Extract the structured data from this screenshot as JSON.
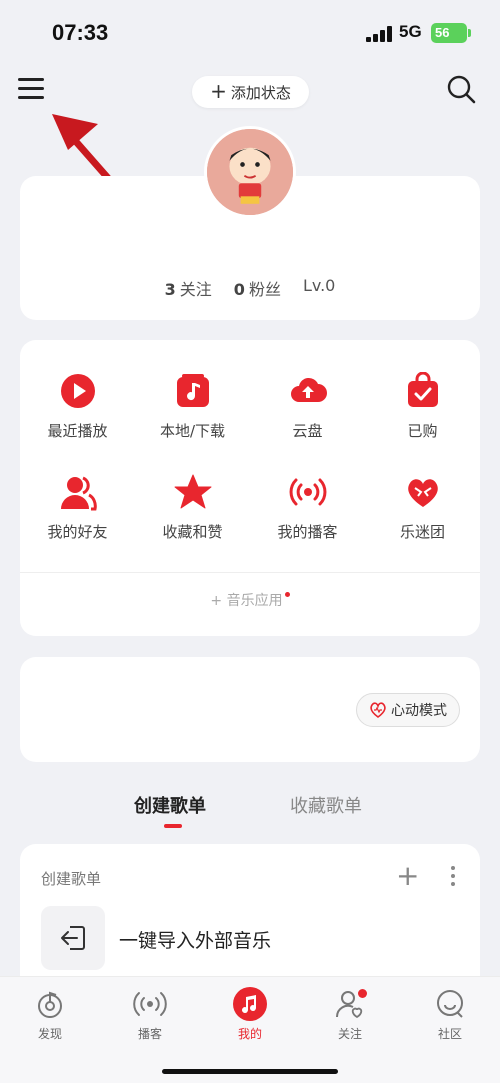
{
  "status_bar": {
    "time": "07:33",
    "network": "5G",
    "battery": "56"
  },
  "header": {
    "add_status_label": "添加状态",
    "menu_icon": "hamburger-menu-icon",
    "search_icon": "search-icon"
  },
  "profile": {
    "follows_count": "3",
    "follows_label": "关注",
    "fans_count": "0",
    "fans_label": "粉丝",
    "level": "Lv.0"
  },
  "apps": {
    "items": [
      {
        "label": "最近播放",
        "icon": "play-circle-icon"
      },
      {
        "label": "本地/下载",
        "icon": "music-note-icon"
      },
      {
        "label": "云盘",
        "icon": "cloud-upload-icon"
      },
      {
        "label": "已购",
        "icon": "shopping-bag-icon"
      },
      {
        "label": "我的好友",
        "icon": "friends-icon"
      },
      {
        "label": "收藏和赞",
        "icon": "star-icon"
      },
      {
        "label": "我的播客",
        "icon": "broadcast-icon"
      },
      {
        "label": "乐迷团",
        "icon": "heart-badge-icon"
      }
    ],
    "music_apps_label": "音乐应用"
  },
  "heart_mode": {
    "label": "心动模式"
  },
  "playlist_tabs": {
    "created": "创建歌单",
    "collected": "收藏歌单"
  },
  "playlists": {
    "header": "创建歌单",
    "import_label": "一键导入外部音乐"
  },
  "bottom_nav": [
    {
      "label": "发现",
      "icon": "discover-icon"
    },
    {
      "label": "播客",
      "icon": "podcast-icon"
    },
    {
      "label": "我的",
      "icon": "music-note-icon"
    },
    {
      "label": "关注",
      "icon": "follow-icon"
    },
    {
      "label": "社区",
      "icon": "community-icon"
    }
  ],
  "colors": {
    "accent": "#e8262e",
    "background": "#f0f1f5",
    "card": "#ffffff"
  }
}
